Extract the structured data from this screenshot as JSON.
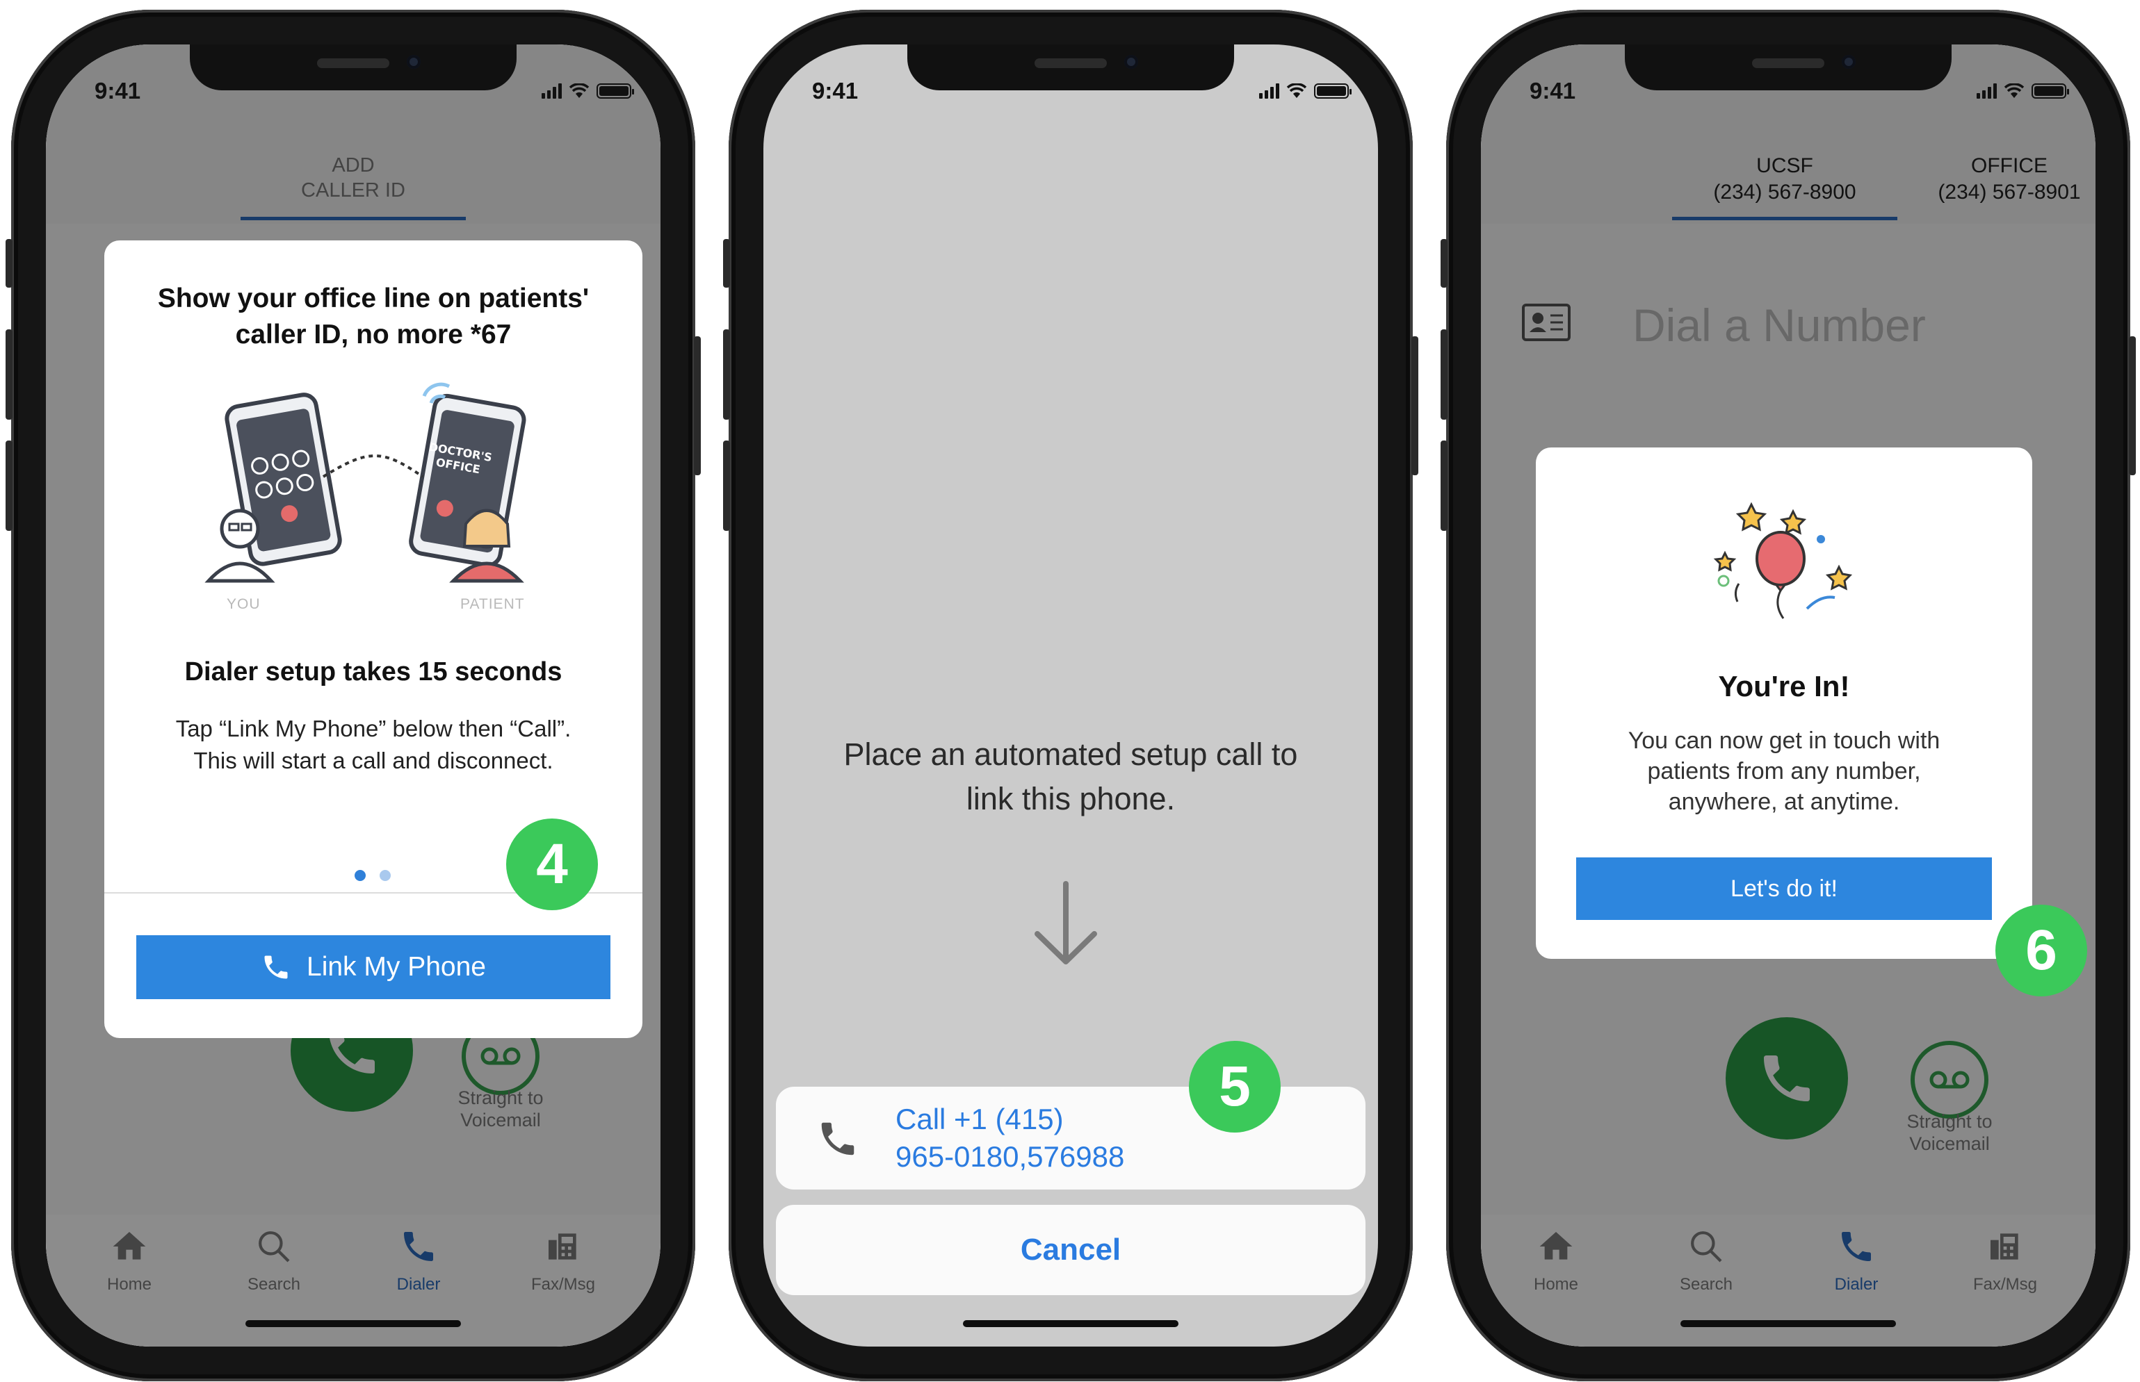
{
  "status": {
    "time": "9:41"
  },
  "tabbar": [
    {
      "key": "home",
      "label": "Home",
      "icon": "home-icon"
    },
    {
      "key": "search",
      "label": "Search",
      "icon": "search-icon"
    },
    {
      "key": "dialer",
      "label": "Dialer",
      "icon": "phone-icon"
    },
    {
      "key": "fax",
      "label": "Fax/Msg",
      "icon": "fax-icon"
    }
  ],
  "screen1": {
    "header_tab": "ADD\nCALLER ID",
    "card": {
      "title": "Show your office line on patients'\ncaller ID, no more *67",
      "illus_you": "YOU",
      "illus_patient": "PATIENT",
      "illus_office": "DOCTOR'S\nOFFICE",
      "subtitle": "Dialer setup takes 15 seconds",
      "body": "Tap “Link My Phone” below then “Call”.\nThis will start a call and disconnect.",
      "button": "Link My Phone"
    },
    "voicemail_label": "Straight to\nVoicemail",
    "badge": "4"
  },
  "screen2": {
    "prompt": "Place an automated setup call to\nlink this phone.",
    "call_action": "Call +1 (415)\n965-0180,576988",
    "cancel": "Cancel",
    "badge": "5"
  },
  "screen3": {
    "header_tabs": [
      {
        "name": "UCSF",
        "number": "(234) 567-8900"
      },
      {
        "name": "OFFICE",
        "number": "(234) 567-8901"
      }
    ],
    "dial_placeholder": "Dial a Number",
    "card": {
      "title": "You're In!",
      "body": "You can now get in touch with\npatients from any number,\nanywhere, at anytime.",
      "button": "Let's do it!"
    },
    "voicemail_label": "Straight to\nVoicemail",
    "badge": "6"
  },
  "colors": {
    "primary_blue": "#2d86de",
    "accent_blue": "#2d6cc0",
    "call_green": "#2a9b45",
    "badge_green": "#3bc95a"
  }
}
